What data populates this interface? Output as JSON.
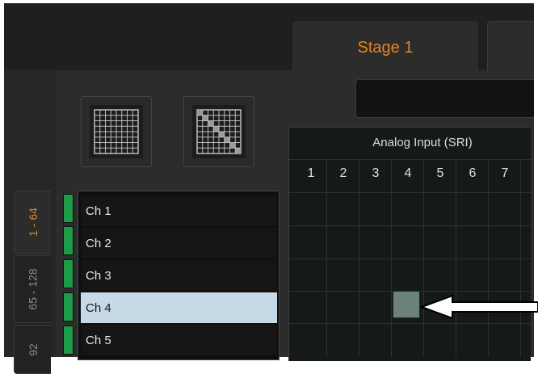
{
  "tabs": {
    "active": "Stage 1"
  },
  "bank_tabs": [
    "1 - 64",
    "65 - 128",
    "92"
  ],
  "channels": [
    {
      "label": "Ch 1",
      "selected": false
    },
    {
      "label": "Ch 2",
      "selected": false
    },
    {
      "label": "Ch 3",
      "selected": false
    },
    {
      "label": "Ch 4",
      "selected": true
    },
    {
      "label": "Ch 5",
      "selected": false
    }
  ],
  "matrix": {
    "title": "Analog Input (SRI)",
    "columns": [
      "1",
      "2",
      "3",
      "4",
      "5",
      "6",
      "7"
    ],
    "active_crosspoint": {
      "row": "Ch 4",
      "column": "4"
    }
  },
  "colors": {
    "accent": "#e7851f",
    "strip": "#1f9a48",
    "selected_row": "#c5d9e6",
    "crosspoint": "#6b817c"
  },
  "icons": {
    "grid_view": "grid-view-icon",
    "diagonal_view": "diagonal-view-icon",
    "callout": "callout-arrow-icon"
  }
}
